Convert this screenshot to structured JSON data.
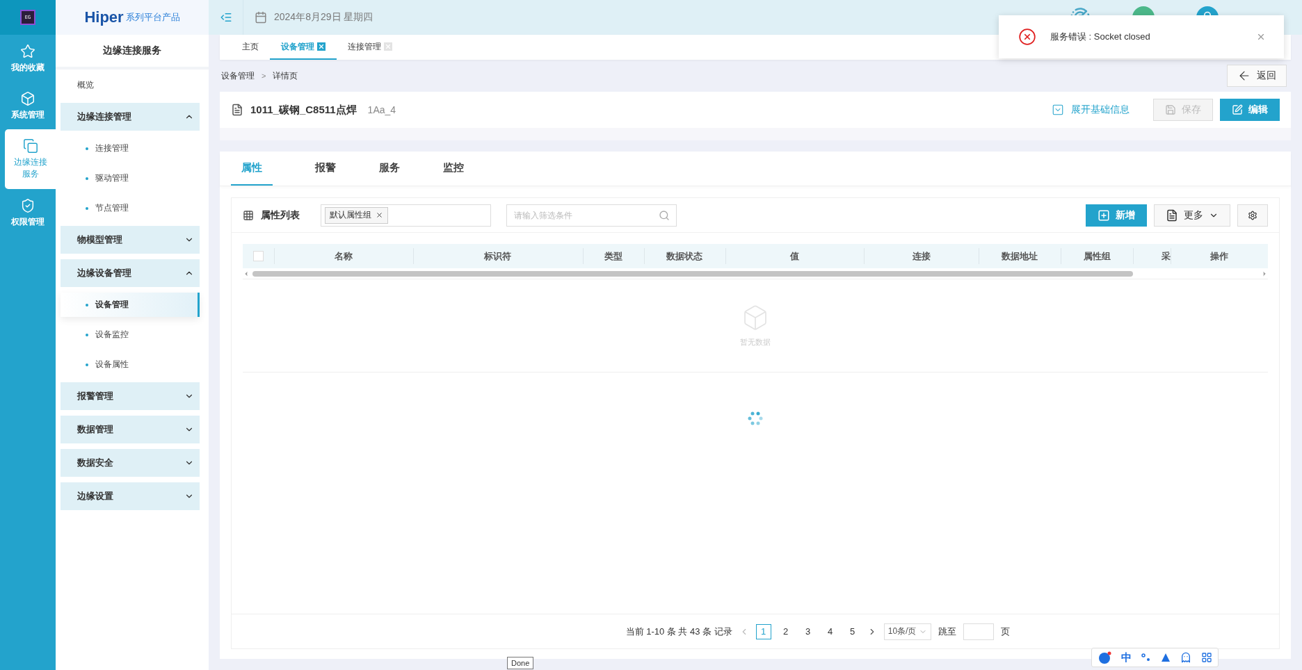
{
  "rail": {
    "logo_text": "EG",
    "items": [
      {
        "label": "我的收藏",
        "selected": false
      },
      {
        "label": "系统管理",
        "selected": false
      },
      {
        "label": "边缘连接服务",
        "selected": true
      },
      {
        "label": "权限管理",
        "selected": false
      }
    ]
  },
  "sidebar": {
    "brand": "Hiper",
    "brand_suffix": "系列平台产品",
    "title": "边缘连接服务",
    "items": [
      {
        "label": "概览",
        "kind": "link"
      },
      {
        "label": "边缘连接管理",
        "kind": "group",
        "expanded": true,
        "children": [
          {
            "label": "连接管理",
            "selected": false
          },
          {
            "label": "驱动管理",
            "selected": false
          },
          {
            "label": "节点管理",
            "selected": false
          }
        ]
      },
      {
        "label": "物模型管理",
        "kind": "group",
        "expanded": false
      },
      {
        "label": "边缘设备管理",
        "kind": "group",
        "expanded": true,
        "children": [
          {
            "label": "设备管理",
            "selected": true
          },
          {
            "label": "设备监控",
            "selected": false
          },
          {
            "label": "设备属性",
            "selected": false
          }
        ]
      },
      {
        "label": "报警管理",
        "kind": "group",
        "expanded": false
      },
      {
        "label": "数据管理",
        "kind": "group",
        "expanded": false
      },
      {
        "label": "数据安全",
        "kind": "group",
        "expanded": false
      },
      {
        "label": "边缘设置",
        "kind": "group",
        "expanded": false
      }
    ]
  },
  "header": {
    "date": "2024年8月29日 星期四"
  },
  "page_tabs": [
    {
      "label": "主页",
      "selected": false,
      "closable": false
    },
    {
      "label": "设备管理",
      "selected": true,
      "closable": true
    },
    {
      "label": "连接管理",
      "selected": false,
      "closable": true
    }
  ],
  "breadcrumb": {
    "items": [
      "设备管理",
      "详情页"
    ],
    "separator": ">"
  },
  "back_button": "返回",
  "device": {
    "title": "1011_碳钢_C8511点焊",
    "code": "1Aa_4",
    "expand_link": "展开基础信息",
    "save_button": {
      "label": "保存",
      "disabled": true
    },
    "edit_button": "编辑"
  },
  "detail_tabs": [
    {
      "label": "属性",
      "selected": true
    },
    {
      "label": "报警",
      "selected": false
    },
    {
      "label": "服务",
      "selected": false
    },
    {
      "label": "监控",
      "selected": false
    }
  ],
  "panel": {
    "title": "属性列表",
    "tags": [
      {
        "label": "默认属性组"
      }
    ],
    "filter": {
      "placeholder": "请输入筛选条件"
    },
    "add_button": "新增",
    "more_button": "更多",
    "table": {
      "select_all_checked": false,
      "columns": [
        "名称",
        "标识符",
        "类型",
        "数据状态",
        "值",
        "连接",
        "数据地址",
        "属性组",
        "采",
        "操作"
      ],
      "empty": "暂无数据",
      "loading": true
    },
    "pagination": {
      "summary": "当前 1-10 条 共 43 条 记录",
      "pages": [
        {
          "label": "1",
          "selected": true
        },
        {
          "label": "2",
          "selected": false
        },
        {
          "label": "3",
          "selected": false
        },
        {
          "label": "4",
          "selected": false
        },
        {
          "label": "5",
          "selected": false
        }
      ],
      "page_size": "10条/页",
      "jump_label": "跳至",
      "page_unit": "页"
    }
  },
  "toast": {
    "message": "服务错误 : Socket closed"
  },
  "ime_bar": {
    "mode": "中"
  },
  "tooltip": "Done"
}
